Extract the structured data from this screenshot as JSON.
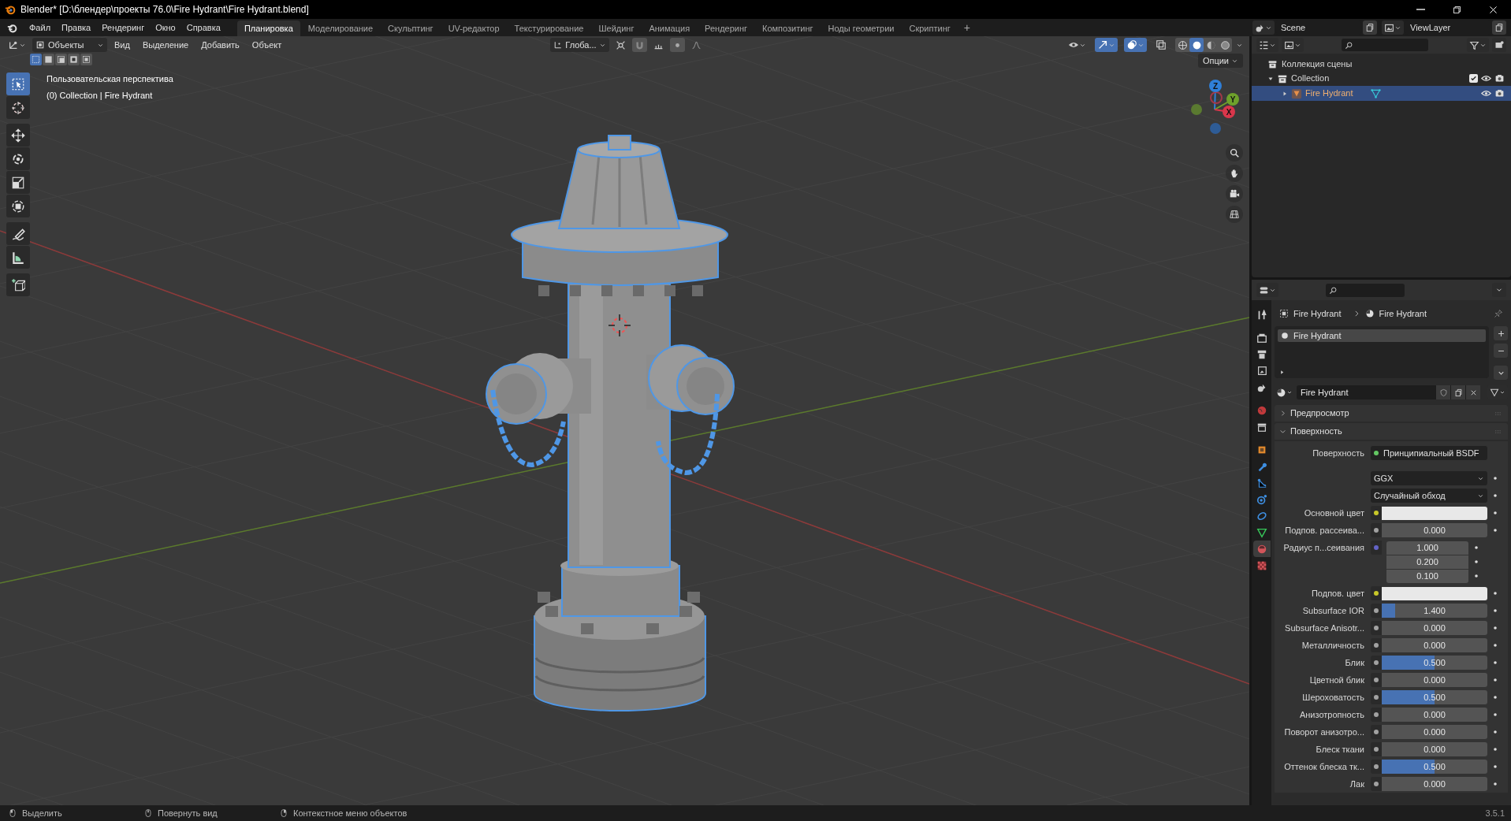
{
  "window": {
    "title": "Blender* [D:\\блендер\\проекты 76.0\\Fire Hydrant\\Fire Hydrant.blend]"
  },
  "menu": [
    "Файл",
    "Правка",
    "Рендеринг",
    "Окно",
    "Справка"
  ],
  "workspaces": [
    {
      "label": "Планировка",
      "selected": true
    },
    {
      "label": "Моделирование",
      "selected": false
    },
    {
      "label": "Скульптинг",
      "selected": false
    },
    {
      "label": "UV-редактор",
      "selected": false
    },
    {
      "label": "Текстурирование",
      "selected": false
    },
    {
      "label": "Шейдинг",
      "selected": false
    },
    {
      "label": "Анимация",
      "selected": false
    },
    {
      "label": "Рендеринг",
      "selected": false
    },
    {
      "label": "Композитинг",
      "selected": false
    },
    {
      "label": "Ноды геометрии",
      "selected": false
    },
    {
      "label": "Скриптинг",
      "selected": false
    }
  ],
  "add_workspace": "+",
  "scene": "Scene",
  "view_layer": "ViewLayer",
  "viewport": {
    "mode": "Объекты",
    "menus": [
      "Вид",
      "Выделение",
      "Добавить",
      "Объект"
    ],
    "orientation": "Глоба...",
    "options": "Опции",
    "select_modes": [
      {
        "selected": true
      },
      {
        "selected": false
      },
      {
        "selected": false
      },
      {
        "selected": false
      },
      {
        "selected": false
      }
    ],
    "shading": [
      {
        "selected": false
      },
      {
        "selected": true
      },
      {
        "selected": false
      },
      {
        "selected": false
      }
    ],
    "view_name": "Пользовательская перспектива",
    "object_info": "(0) Collection | Fire Hydrant",
    "gizmo": [
      "Z",
      "Y",
      "X"
    ],
    "tools": [
      {
        "selected": true
      },
      {
        "selected": false
      },
      {
        "selected": false
      },
      {
        "selected": false
      },
      {
        "selected": false
      },
      {
        "selected": false
      },
      {
        "selected": false
      },
      {
        "selected": false
      },
      {
        "selected": false
      }
    ]
  },
  "outliner": {
    "root": "Коллекция сцены",
    "items": [
      {
        "label": "Collection",
        "expanded": true,
        "checked": true,
        "selected": false,
        "children": [
          {
            "label": "Fire Hydrant",
            "expanded": false,
            "selected": true
          }
        ]
      }
    ]
  },
  "properties": {
    "tabs": [
      {
        "selected": false
      },
      {
        "selected": false
      },
      {
        "selected": false
      },
      {
        "selected": false
      },
      {
        "selected": false
      },
      {
        "selected": false
      },
      {
        "selected": false
      },
      {
        "selected": false
      },
      {
        "selected": false
      },
      {
        "selected": false
      },
      {
        "selected": false
      },
      {
        "selected": false
      },
      {
        "selected": false
      },
      {
        "selected": true
      },
      {
        "selected": false
      }
    ],
    "breadcrumb": [
      "Fire Hydrant",
      "Fire Hydrant"
    ],
    "material_slots": [
      {
        "label": "Fire Hydrant",
        "selected": true
      }
    ],
    "material": "Fire Hydrant",
    "panels": [
      {
        "label": "Предпросмотр",
        "expanded": false
      },
      {
        "label": "Поверхность",
        "expanded": true
      }
    ],
    "rows": [
      {
        "kind": "shader",
        "label": "Поверхность",
        "color": "#63c763",
        "value": "Принципиальный BSDF"
      },
      {
        "kind": "dropdown",
        "value": "GGX"
      },
      {
        "kind": "dropdown",
        "value": "Случайный обход"
      },
      {
        "kind": "color",
        "label": "Основной цвет",
        "color": "#c7c729"
      },
      {
        "kind": "slider",
        "label": "Подпов. рассеива...",
        "color": "#a1a1a1",
        "value": "0.000",
        "level": 0
      },
      {
        "kind": "vector",
        "label": "Радиус п...сеивания",
        "color": "#6363c7",
        "values": [
          "1.000",
          "0.200",
          "0.100"
        ]
      },
      {
        "kind": "color",
        "label": "Подпов. цвет",
        "color": "#c7c729"
      },
      {
        "kind": "slider",
        "label": "Subsurface IOR",
        "color": "#a1a1a1",
        "value": "1.400",
        "level": 0.13
      },
      {
        "kind": "slider",
        "label": "Subsurface Anisotr...",
        "color": "#a1a1a1",
        "value": "0.000",
        "level": 0
      },
      {
        "kind": "slider",
        "label": "Металличность",
        "color": "#a1a1a1",
        "value": "0.000",
        "level": 0
      },
      {
        "kind": "slider",
        "label": "Блик",
        "color": "#a1a1a1",
        "value": "0.500",
        "level": 0.5
      },
      {
        "kind": "slider",
        "label": "Цветной блик",
        "color": "#a1a1a1",
        "value": "0.000",
        "level": 0
      },
      {
        "kind": "slider",
        "label": "Шероховатость",
        "color": "#a1a1a1",
        "value": "0.500",
        "level": 0.5
      },
      {
        "kind": "slider",
        "label": "Анизотропность",
        "color": "#a1a1a1",
        "value": "0.000",
        "level": 0
      },
      {
        "kind": "slider",
        "label": "Поворот анизотро...",
        "color": "#a1a1a1",
        "value": "0.000",
        "level": 0
      },
      {
        "kind": "slider",
        "label": "Блеск ткани",
        "color": "#a1a1a1",
        "value": "0.000",
        "level": 0
      },
      {
        "kind": "slider",
        "label": "Оттенок блеска тк...",
        "color": "#a1a1a1",
        "value": "0.500",
        "level": 0.5
      },
      {
        "kind": "slider",
        "label": "Лак",
        "color": "#a1a1a1",
        "value": "0.000",
        "level": 0
      }
    ]
  },
  "status_bar": {
    "hints": [
      "Выделить",
      "Повернуть вид",
      "Контекстное меню объектов"
    ],
    "version": "3.5.1"
  }
}
